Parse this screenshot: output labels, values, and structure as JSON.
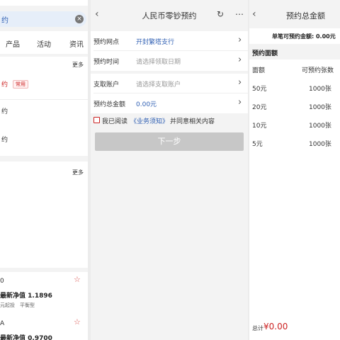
{
  "left": {
    "search_text": "约",
    "clear_icon": "close-circle-icon",
    "nav": [
      "产品",
      "活动",
      "资讯"
    ],
    "section1": {
      "more": "更多",
      "items": [
        {
          "text": "约",
          "badge": "常用"
        },
        {
          "text": "约"
        },
        {
          "text": "约"
        }
      ]
    },
    "section2": {
      "more": "更多"
    },
    "funds": [
      {
        "code": "0",
        "nav_text": "最新净值 1.1896",
        "tag1": "元起投",
        "tag2": "平衡型"
      },
      {
        "code": "A",
        "nav_text": "最新净值 0.9700"
      }
    ]
  },
  "middle": {
    "title": "人民币零钞预约",
    "rows": [
      {
        "label": "预约网点",
        "value": "开封繁塔支行",
        "value_type": "blue"
      },
      {
        "label": "预约时间",
        "value": "请选择领取日期",
        "value_type": "placeholder"
      },
      {
        "label": "支取账户",
        "value": "请选择支取账户",
        "value_type": "placeholder"
      },
      {
        "label": "预约总金额",
        "value": "0.00元",
        "value_type": "blue"
      }
    ],
    "agree_prefix": "我已阅读",
    "agree_link": "《业务须知》",
    "agree_suffix": "并同意相关内容",
    "next_button": "下一步"
  },
  "right": {
    "title": "预约总金额",
    "max_line": "单笔可预约金额: 0.00元",
    "section_title": "预约面额",
    "headers": [
      "面额",
      "可预约张数"
    ],
    "rows": [
      {
        "denom": "50元",
        "count": "1000张"
      },
      {
        "denom": "20元",
        "count": "1000张"
      },
      {
        "denom": "10元",
        "count": "1000张"
      },
      {
        "denom": "5元",
        "count": "1000张"
      }
    ],
    "total_label": "总计",
    "total_value": "¥0.00"
  },
  "colors": {
    "accent_blue": "#2f5fb3",
    "accent_red": "#cc2222",
    "button_disabled": "#c7c7c7"
  }
}
